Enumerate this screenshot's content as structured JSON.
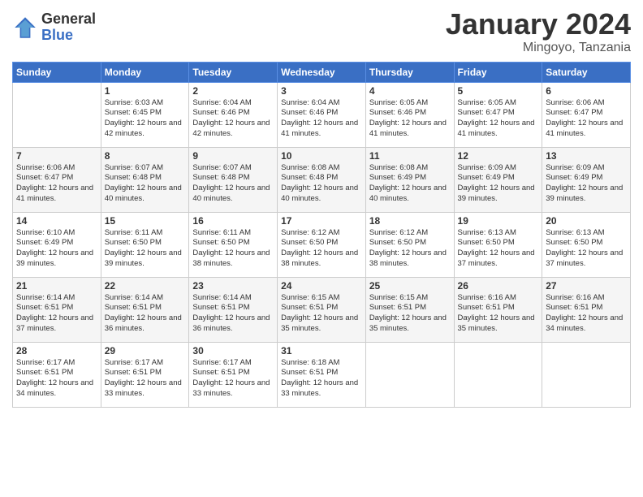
{
  "logo": {
    "general": "General",
    "blue": "Blue"
  },
  "title": "January 2024",
  "subtitle": "Mingoyo, Tanzania",
  "days_of_week": [
    "Sunday",
    "Monday",
    "Tuesday",
    "Wednesday",
    "Thursday",
    "Friday",
    "Saturday"
  ],
  "weeks": [
    [
      {
        "day": "",
        "sunrise": "",
        "sunset": "",
        "daylight": ""
      },
      {
        "day": "1",
        "sunrise": "Sunrise: 6:03 AM",
        "sunset": "Sunset: 6:45 PM",
        "daylight": "Daylight: 12 hours and 42 minutes."
      },
      {
        "day": "2",
        "sunrise": "Sunrise: 6:04 AM",
        "sunset": "Sunset: 6:46 PM",
        "daylight": "Daylight: 12 hours and 42 minutes."
      },
      {
        "day": "3",
        "sunrise": "Sunrise: 6:04 AM",
        "sunset": "Sunset: 6:46 PM",
        "daylight": "Daylight: 12 hours and 41 minutes."
      },
      {
        "day": "4",
        "sunrise": "Sunrise: 6:05 AM",
        "sunset": "Sunset: 6:46 PM",
        "daylight": "Daylight: 12 hours and 41 minutes."
      },
      {
        "day": "5",
        "sunrise": "Sunrise: 6:05 AM",
        "sunset": "Sunset: 6:47 PM",
        "daylight": "Daylight: 12 hours and 41 minutes."
      },
      {
        "day": "6",
        "sunrise": "Sunrise: 6:06 AM",
        "sunset": "Sunset: 6:47 PM",
        "daylight": "Daylight: 12 hours and 41 minutes."
      }
    ],
    [
      {
        "day": "7",
        "sunrise": "Sunrise: 6:06 AM",
        "sunset": "Sunset: 6:47 PM",
        "daylight": "Daylight: 12 hours and 41 minutes."
      },
      {
        "day": "8",
        "sunrise": "Sunrise: 6:07 AM",
        "sunset": "Sunset: 6:48 PM",
        "daylight": "Daylight: 12 hours and 40 minutes."
      },
      {
        "day": "9",
        "sunrise": "Sunrise: 6:07 AM",
        "sunset": "Sunset: 6:48 PM",
        "daylight": "Daylight: 12 hours and 40 minutes."
      },
      {
        "day": "10",
        "sunrise": "Sunrise: 6:08 AM",
        "sunset": "Sunset: 6:48 PM",
        "daylight": "Daylight: 12 hours and 40 minutes."
      },
      {
        "day": "11",
        "sunrise": "Sunrise: 6:08 AM",
        "sunset": "Sunset: 6:49 PM",
        "daylight": "Daylight: 12 hours and 40 minutes."
      },
      {
        "day": "12",
        "sunrise": "Sunrise: 6:09 AM",
        "sunset": "Sunset: 6:49 PM",
        "daylight": "Daylight: 12 hours and 39 minutes."
      },
      {
        "day": "13",
        "sunrise": "Sunrise: 6:09 AM",
        "sunset": "Sunset: 6:49 PM",
        "daylight": "Daylight: 12 hours and 39 minutes."
      }
    ],
    [
      {
        "day": "14",
        "sunrise": "Sunrise: 6:10 AM",
        "sunset": "Sunset: 6:49 PM",
        "daylight": "Daylight: 12 hours and 39 minutes."
      },
      {
        "day": "15",
        "sunrise": "Sunrise: 6:11 AM",
        "sunset": "Sunset: 6:50 PM",
        "daylight": "Daylight: 12 hours and 39 minutes."
      },
      {
        "day": "16",
        "sunrise": "Sunrise: 6:11 AM",
        "sunset": "Sunset: 6:50 PM",
        "daylight": "Daylight: 12 hours and 38 minutes."
      },
      {
        "day": "17",
        "sunrise": "Sunrise: 6:12 AM",
        "sunset": "Sunset: 6:50 PM",
        "daylight": "Daylight: 12 hours and 38 minutes."
      },
      {
        "day": "18",
        "sunrise": "Sunrise: 6:12 AM",
        "sunset": "Sunset: 6:50 PM",
        "daylight": "Daylight: 12 hours and 38 minutes."
      },
      {
        "day": "19",
        "sunrise": "Sunrise: 6:13 AM",
        "sunset": "Sunset: 6:50 PM",
        "daylight": "Daylight: 12 hours and 37 minutes."
      },
      {
        "day": "20",
        "sunrise": "Sunrise: 6:13 AM",
        "sunset": "Sunset: 6:50 PM",
        "daylight": "Daylight: 12 hours and 37 minutes."
      }
    ],
    [
      {
        "day": "21",
        "sunrise": "Sunrise: 6:14 AM",
        "sunset": "Sunset: 6:51 PM",
        "daylight": "Daylight: 12 hours and 37 minutes."
      },
      {
        "day": "22",
        "sunrise": "Sunrise: 6:14 AM",
        "sunset": "Sunset: 6:51 PM",
        "daylight": "Daylight: 12 hours and 36 minutes."
      },
      {
        "day": "23",
        "sunrise": "Sunrise: 6:14 AM",
        "sunset": "Sunset: 6:51 PM",
        "daylight": "Daylight: 12 hours and 36 minutes."
      },
      {
        "day": "24",
        "sunrise": "Sunrise: 6:15 AM",
        "sunset": "Sunset: 6:51 PM",
        "daylight": "Daylight: 12 hours and 35 minutes."
      },
      {
        "day": "25",
        "sunrise": "Sunrise: 6:15 AM",
        "sunset": "Sunset: 6:51 PM",
        "daylight": "Daylight: 12 hours and 35 minutes."
      },
      {
        "day": "26",
        "sunrise": "Sunrise: 6:16 AM",
        "sunset": "Sunset: 6:51 PM",
        "daylight": "Daylight: 12 hours and 35 minutes."
      },
      {
        "day": "27",
        "sunrise": "Sunrise: 6:16 AM",
        "sunset": "Sunset: 6:51 PM",
        "daylight": "Daylight: 12 hours and 34 minutes."
      }
    ],
    [
      {
        "day": "28",
        "sunrise": "Sunrise: 6:17 AM",
        "sunset": "Sunset: 6:51 PM",
        "daylight": "Daylight: 12 hours and 34 minutes."
      },
      {
        "day": "29",
        "sunrise": "Sunrise: 6:17 AM",
        "sunset": "Sunset: 6:51 PM",
        "daylight": "Daylight: 12 hours and 33 minutes."
      },
      {
        "day": "30",
        "sunrise": "Sunrise: 6:17 AM",
        "sunset": "Sunset: 6:51 PM",
        "daylight": "Daylight: 12 hours and 33 minutes."
      },
      {
        "day": "31",
        "sunrise": "Sunrise: 6:18 AM",
        "sunset": "Sunset: 6:51 PM",
        "daylight": "Daylight: 12 hours and 33 minutes."
      },
      {
        "day": "",
        "sunrise": "",
        "sunset": "",
        "daylight": ""
      },
      {
        "day": "",
        "sunrise": "",
        "sunset": "",
        "daylight": ""
      },
      {
        "day": "",
        "sunrise": "",
        "sunset": "",
        "daylight": ""
      }
    ]
  ]
}
